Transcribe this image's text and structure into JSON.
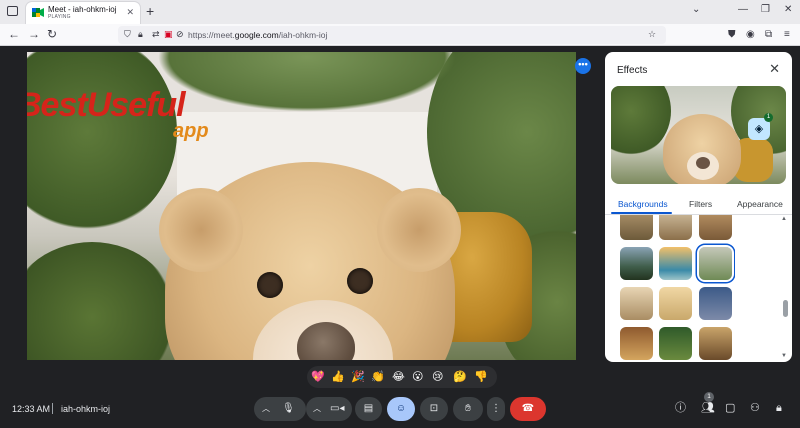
{
  "browser": {
    "tab_title": "Meet - iah-ohkm-ioj",
    "tab_subtitle": "PLAYING",
    "new_tab": "+",
    "url_prefix": "https://meet.",
    "url_domain": "google.com",
    "url_path": "/iah-ohkm-ioj",
    "window_controls": [
      "minimize",
      "restore",
      "close"
    ]
  },
  "watermark": {
    "line1": "BestUseful",
    "line2": "app"
  },
  "effects_panel": {
    "title": "Effects",
    "tabs": [
      {
        "label": "Backgrounds",
        "active": true
      },
      {
        "label": "Filters",
        "active": false
      },
      {
        "label": "Appearance",
        "active": false
      }
    ],
    "layers_badge": "1",
    "selected_thumbnail": "row2-col3"
  },
  "reactions": [
    "💖",
    "👍",
    "🎉",
    "👏",
    "😂",
    "😮",
    "😢",
    "🤔",
    "👎"
  ],
  "bottom_bar": {
    "time": "12:33 AM",
    "meeting_code": "iah-ohkm-ioj",
    "people_count": "1"
  },
  "colors": {
    "accent": "#0b57d0",
    "end_call": "#dc362e",
    "selected_control": "#a8c7fa"
  }
}
